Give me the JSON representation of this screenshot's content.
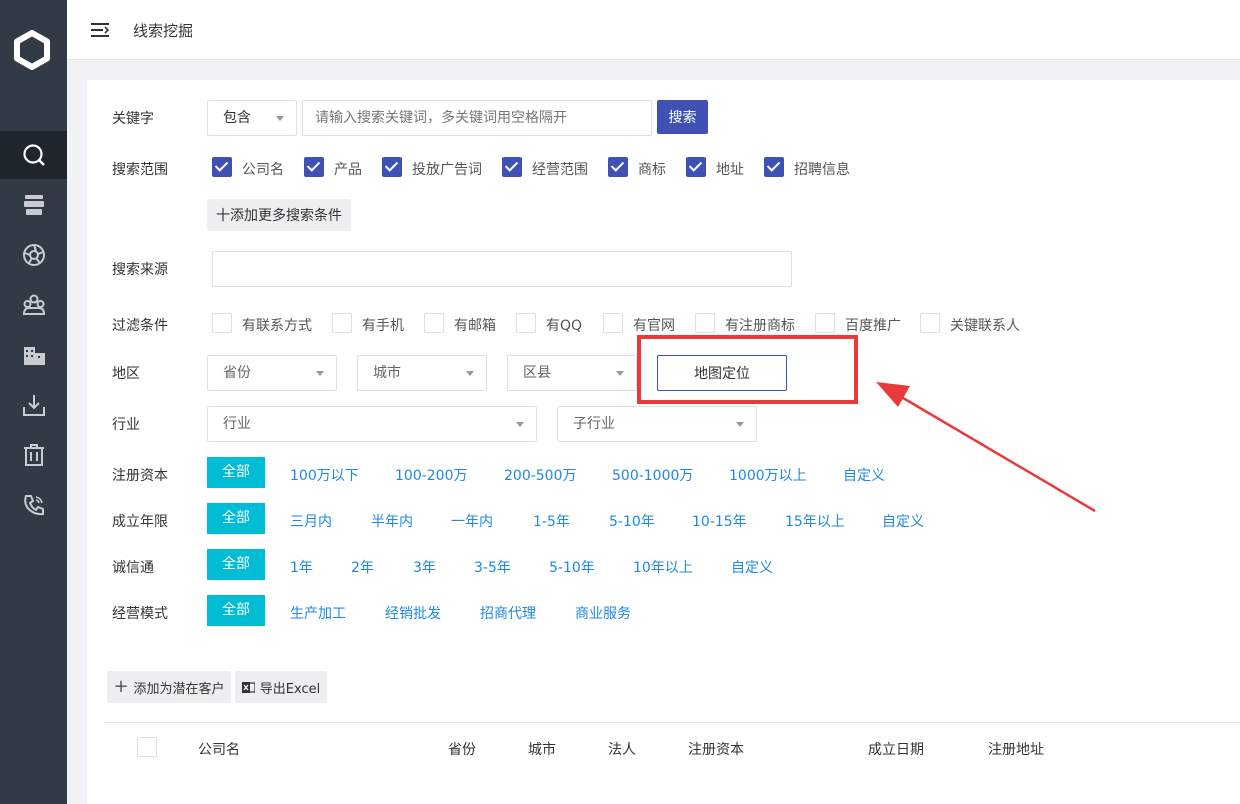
{
  "header": {
    "title": "线索挖掘"
  },
  "sidebar": {
    "items": [
      {
        "name": "search",
        "active": true
      },
      {
        "name": "database",
        "active": false
      },
      {
        "name": "aperture",
        "active": false
      },
      {
        "name": "users",
        "active": false
      },
      {
        "name": "building",
        "active": false
      },
      {
        "name": "download",
        "active": false
      },
      {
        "name": "trash",
        "active": false
      },
      {
        "name": "phone",
        "active": false
      }
    ]
  },
  "keyword": {
    "label": "关键字",
    "mode": "包含",
    "placeholder": "请输入搜索关键词，多关键词用空格隔开",
    "search_button": "搜索"
  },
  "scope": {
    "label": "搜索范围",
    "options": [
      "公司名",
      "产品",
      "投放广告词",
      "经营范围",
      "商标",
      "地址",
      "招聘信息"
    ],
    "add_more": "十添加更多搜索条件"
  },
  "source": {
    "label": "搜索来源",
    "value": ""
  },
  "filters": {
    "label": "过滤条件",
    "options": [
      "有联系方式",
      "有手机",
      "有邮箱",
      "有QQ",
      "有官网",
      "有注册商标",
      "百度推广",
      "关键联系人"
    ]
  },
  "region": {
    "label": "地区",
    "province": "省份",
    "city": "城市",
    "district": "区县",
    "map_button": "地图定位"
  },
  "industry": {
    "label": "行业",
    "industry": "行业",
    "sub_industry": "子行业"
  },
  "capital": {
    "label": "注册资本",
    "all": "全部",
    "options": [
      "100万以下",
      "100-200万",
      "200-500万",
      "500-1000万",
      "1000万以上",
      "自定义"
    ]
  },
  "founded": {
    "label": "成立年限",
    "all": "全部",
    "options": [
      "三月内",
      "半年内",
      "一年内",
      "1-5年",
      "5-10年",
      "10-15年",
      "15年以上",
      "自定义"
    ]
  },
  "chengxin": {
    "label": "诚信通",
    "all": "全部",
    "options": [
      "1年",
      "2年",
      "3年",
      "3-5年",
      "5-10年",
      "10年以上",
      "自定义"
    ]
  },
  "business_mode": {
    "label": "经营模式",
    "all": "全部",
    "options": [
      "生产加工",
      "经销批发",
      "招商代理",
      "商业服务"
    ]
  },
  "actions": {
    "add_customer": "添加为潜在客户",
    "export": "导出Excel"
  },
  "table": {
    "columns": [
      "公司名",
      "省份",
      "城市",
      "法人",
      "注册资本",
      "成立日期",
      "注册地址"
    ]
  },
  "colors": {
    "primary": "#3f51b5",
    "accent": "#00bcd4",
    "link": "#1e88e5",
    "highlight": "#e83a3a",
    "sidebar": "#323a45"
  }
}
